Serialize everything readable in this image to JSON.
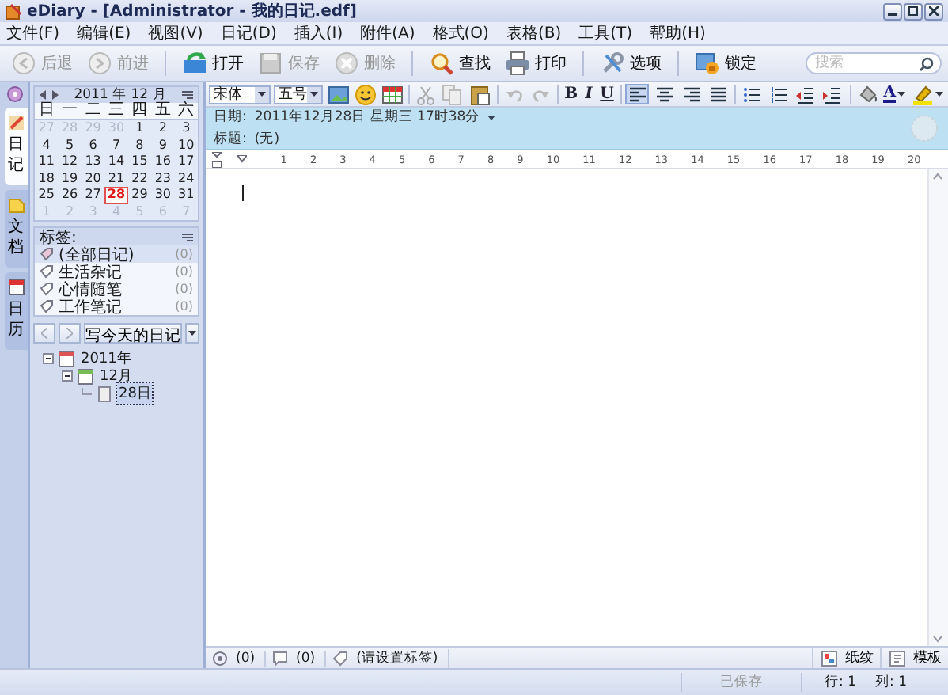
{
  "window": {
    "title": "eDiary - [Administrator - 我的日记.edf]"
  },
  "menu": [
    "文件(F)",
    "编辑(E)",
    "视图(V)",
    "日记(D)",
    "插入(I)",
    "附件(A)",
    "格式(O)",
    "表格(B)",
    "工具(T)",
    "帮助(H)"
  ],
  "toolbar": {
    "buttons": [
      {
        "kind": "back",
        "label": "后退",
        "disabled": true
      },
      {
        "kind": "forward",
        "label": "前进",
        "disabled": true
      },
      {
        "kind": "separator"
      },
      {
        "kind": "open",
        "label": "打开",
        "disabled": false
      },
      {
        "kind": "save",
        "label": "保存",
        "disabled": true
      },
      {
        "kind": "delete",
        "label": "删除",
        "disabled": true
      },
      {
        "kind": "separator"
      },
      {
        "kind": "find",
        "label": "查找",
        "disabled": false
      },
      {
        "kind": "print",
        "label": "打印",
        "disabled": false
      },
      {
        "kind": "separator"
      },
      {
        "kind": "options",
        "label": "选项",
        "disabled": false
      },
      {
        "kind": "separator"
      },
      {
        "kind": "lock",
        "label": "锁定",
        "disabled": false
      }
    ],
    "search": {
      "placeholder": "搜索"
    }
  },
  "side_tabs": [
    {
      "label": "日记",
      "selected": true
    },
    {
      "label": "文档",
      "selected": false
    },
    {
      "label": "日历",
      "selected": false
    }
  ],
  "calendar": {
    "title": "2011 年 12 月",
    "weekdays": [
      "日",
      "一",
      "二",
      "三",
      "四",
      "五",
      "六"
    ],
    "days": [
      {
        "label": "27",
        "muted": true,
        "selected": false
      },
      {
        "label": "28",
        "muted": true,
        "selected": false
      },
      {
        "label": "29",
        "muted": true,
        "selected": false
      },
      {
        "label": "30",
        "muted": true,
        "selected": false
      },
      {
        "label": "1",
        "muted": false,
        "selected": false
      },
      {
        "label": "2",
        "muted": false,
        "selected": false
      },
      {
        "label": "3",
        "muted": false,
        "selected": false
      },
      {
        "label": "4",
        "muted": false,
        "selected": false
      },
      {
        "label": "5",
        "muted": false,
        "selected": false
      },
      {
        "label": "6",
        "muted": false,
        "selected": false
      },
      {
        "label": "7",
        "muted": false,
        "selected": false
      },
      {
        "label": "8",
        "muted": false,
        "selected": false
      },
      {
        "label": "9",
        "muted": false,
        "selected": false
      },
      {
        "label": "10",
        "muted": false,
        "selected": false
      },
      {
        "label": "11",
        "muted": false,
        "selected": false
      },
      {
        "label": "12",
        "muted": false,
        "selected": false
      },
      {
        "label": "13",
        "muted": false,
        "selected": false
      },
      {
        "label": "14",
        "muted": false,
        "selected": false
      },
      {
        "label": "15",
        "muted": false,
        "selected": false
      },
      {
        "label": "16",
        "muted": false,
        "selected": false
      },
      {
        "label": "17",
        "muted": false,
        "selected": false
      },
      {
        "label": "18",
        "muted": false,
        "selected": false
      },
      {
        "label": "19",
        "muted": false,
        "selected": false
      },
      {
        "label": "20",
        "muted": false,
        "selected": false
      },
      {
        "label": "21",
        "muted": false,
        "selected": false
      },
      {
        "label": "22",
        "muted": false,
        "selected": false
      },
      {
        "label": "23",
        "muted": false,
        "selected": false
      },
      {
        "label": "24",
        "muted": false,
        "selected": false
      },
      {
        "label": "25",
        "muted": false,
        "selected": false
      },
      {
        "label": "26",
        "muted": false,
        "selected": false
      },
      {
        "label": "27",
        "muted": false,
        "selected": false
      },
      {
        "label": "28",
        "muted": false,
        "selected": true
      },
      {
        "label": "29",
        "muted": false,
        "selected": false
      },
      {
        "label": "30",
        "muted": false,
        "selected": false
      },
      {
        "label": "31",
        "muted": false,
        "selected": false
      },
      {
        "label": "1",
        "muted": true,
        "selected": false
      },
      {
        "label": "2",
        "muted": true,
        "selected": false
      },
      {
        "label": "3",
        "muted": true,
        "selected": false
      },
      {
        "label": "4",
        "muted": true,
        "selected": false
      },
      {
        "label": "5",
        "muted": true,
        "selected": false
      },
      {
        "label": "6",
        "muted": true,
        "selected": false
      },
      {
        "label": "7",
        "muted": true,
        "selected": false
      }
    ]
  },
  "tags": {
    "title": "标签:",
    "items": [
      {
        "label": "(全部日记)",
        "count": "(0)",
        "selected": true
      },
      {
        "label": "生活杂记",
        "count": "(0)",
        "selected": false
      },
      {
        "label": "心情随笔",
        "count": "(0)",
        "selected": false
      },
      {
        "label": "工作笔记",
        "count": "(0)",
        "selected": false
      }
    ]
  },
  "write_today": {
    "label": "写今天的日记"
  },
  "tree": [
    {
      "label": "2011年",
      "expanded": true,
      "selected": false,
      "children": [
        {
          "label": "12月",
          "expanded": true,
          "selected": false,
          "children": [
            {
              "label": "28日",
              "selected": true
            }
          ]
        }
      ]
    }
  ],
  "format_toolbar": {
    "font": "宋体",
    "size": "五号",
    "tools": [
      {
        "kind": "image",
        "selected": false
      },
      {
        "kind": "emoji",
        "selected": false
      },
      {
        "kind": "table",
        "selected": false
      },
      {
        "kind": "separator"
      },
      {
        "kind": "cut",
        "selected": false
      },
      {
        "kind": "copy",
        "selected": false
      },
      {
        "kind": "paste",
        "selected": false
      },
      {
        "kind": "separator"
      },
      {
        "kind": "undo",
        "selected": false
      },
      {
        "kind": "redo",
        "selected": false
      },
      {
        "kind": "separator"
      },
      {
        "kind": "bold",
        "label": "B",
        "selected": false
      },
      {
        "kind": "italic",
        "label": "I",
        "selected": false
      },
      {
        "kind": "underline",
        "label": "U",
        "selected": false
      },
      {
        "kind": "separator"
      },
      {
        "kind": "align-left",
        "selected": true
      },
      {
        "kind": "align-center",
        "selected": false
      },
      {
        "kind": "align-right",
        "selected": false
      },
      {
        "kind": "justify",
        "selected": false
      },
      {
        "kind": "separator"
      },
      {
        "kind": "bullets",
        "selected": false
      },
      {
        "kind": "numbering",
        "selected": false
      },
      {
        "kind": "outdent",
        "selected": false
      },
      {
        "kind": "indent",
        "selected": false
      },
      {
        "kind": "separator"
      },
      {
        "kind": "fill",
        "selected": false
      },
      {
        "kind": "font-color",
        "label": "A",
        "selected": false
      },
      {
        "kind": "highlight",
        "selected": false
      }
    ]
  },
  "entry": {
    "date_label": "日期:",
    "date": "2011年12月28日 星期三 17时38分",
    "title_label": "标题:",
    "title": "(无)"
  },
  "ruler": [
    "1",
    "2",
    "3",
    "4",
    "5",
    "6",
    "7",
    "8",
    "9",
    "10",
    "11",
    "12",
    "13",
    "14",
    "15",
    "16",
    "17",
    "18",
    "19",
    "20"
  ],
  "bottom_bar": {
    "left": [
      {
        "kind": "attachment",
        "text": "(0)"
      },
      {
        "kind": "comment",
        "text": "(0)"
      },
      {
        "kind": "tag",
        "text": "(请设置标签)"
      }
    ],
    "right": [
      {
        "kind": "paper",
        "text": "纸纹"
      },
      {
        "kind": "template",
        "text": "模板"
      }
    ]
  },
  "status_bar": {
    "saved": "已保存",
    "line": "行: 1",
    "column": "列: 1"
  }
}
